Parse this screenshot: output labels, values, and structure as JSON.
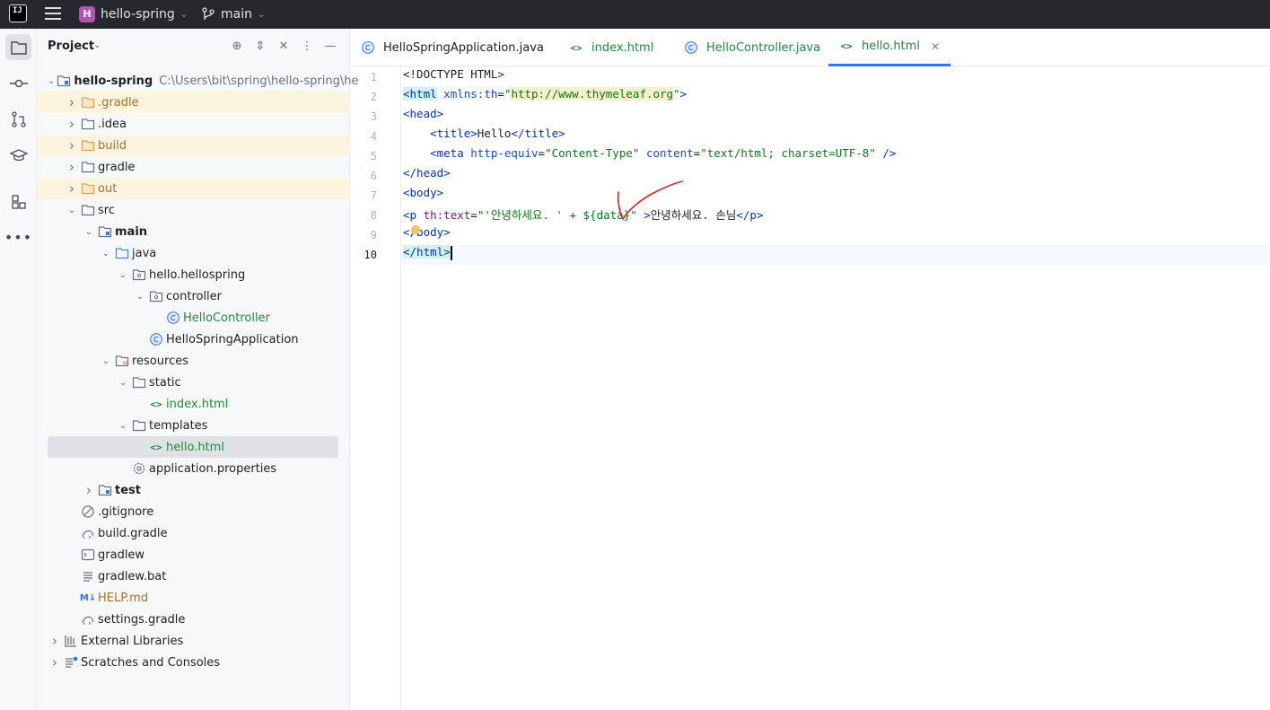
{
  "topbar": {
    "logo_text": "IJ",
    "project_badge": "H",
    "project_name": "hello-spring",
    "branch": "main"
  },
  "toolstrip": {
    "items": [
      "folder-icon",
      "commit-icon",
      "pull-requests-icon",
      "learn-icon",
      "structure-icon",
      "more-icon"
    ]
  },
  "project_panel": {
    "title": "Project",
    "tree": [
      {
        "label": "hello-spring",
        "path": "C:\\Users\\bit\\spring\\hello-spring\\he",
        "depth": 0,
        "expanded": true,
        "icon": "module-folder",
        "bold": true
      },
      {
        "label": ".gradle",
        "depth": 1,
        "expanded": false,
        "icon": "folder-excluded",
        "color": "orange",
        "excluded": true
      },
      {
        "label": ".idea",
        "depth": 1,
        "expanded": false,
        "icon": "folder"
      },
      {
        "label": "build",
        "depth": 1,
        "expanded": false,
        "icon": "folder-excluded",
        "color": "orange",
        "excluded": true
      },
      {
        "label": "gradle",
        "depth": 1,
        "expanded": false,
        "icon": "folder"
      },
      {
        "label": "out",
        "depth": 1,
        "expanded": false,
        "icon": "folder-excluded",
        "color": "orange",
        "excluded": true
      },
      {
        "label": "src",
        "depth": 1,
        "expanded": true,
        "icon": "folder"
      },
      {
        "label": "main",
        "depth": 2,
        "expanded": true,
        "icon": "module-folder",
        "bold": true
      },
      {
        "label": "java",
        "depth": 3,
        "expanded": true,
        "icon": "source-folder"
      },
      {
        "label": "hello.hellospring",
        "depth": 4,
        "expanded": true,
        "icon": "package"
      },
      {
        "label": "controller",
        "depth": 5,
        "expanded": true,
        "icon": "package"
      },
      {
        "label": "HelloController",
        "depth": 6,
        "icon": "class",
        "color": "green"
      },
      {
        "label": "HelloSpringApplication",
        "depth": 5,
        "icon": "class"
      },
      {
        "label": "resources",
        "depth": 3,
        "expanded": true,
        "icon": "resources-folder"
      },
      {
        "label": "static",
        "depth": 4,
        "expanded": true,
        "icon": "folder"
      },
      {
        "label": "index.html",
        "depth": 5,
        "icon": "html",
        "color": "green"
      },
      {
        "label": "templates",
        "depth": 4,
        "expanded": true,
        "icon": "folder"
      },
      {
        "label": "hello.html",
        "depth": 5,
        "icon": "html",
        "color": "green",
        "selected": true
      },
      {
        "label": "application.properties",
        "depth": 4,
        "icon": "settings"
      },
      {
        "label": "test",
        "depth": 2,
        "expanded": false,
        "icon": "module-folder",
        "bold": true
      },
      {
        "label": ".gitignore",
        "depth": 1,
        "icon": "ignore"
      },
      {
        "label": "build.gradle",
        "depth": 1,
        "icon": "gradle"
      },
      {
        "label": "gradlew",
        "depth": 1,
        "icon": "shell"
      },
      {
        "label": "gradlew.bat",
        "depth": 1,
        "icon": "text"
      },
      {
        "label": "HELP.md",
        "depth": 1,
        "icon": "markdown",
        "color": "orange"
      },
      {
        "label": "settings.gradle",
        "depth": 1,
        "icon": "gradle"
      },
      {
        "label": "External Libraries",
        "depth": 0,
        "expanded": false,
        "icon": "libraries"
      },
      {
        "label": "Scratches and Consoles",
        "depth": 0,
        "expanded": false,
        "icon": "scratches"
      }
    ]
  },
  "editor": {
    "tabs": [
      {
        "label": "HelloSpringApplication.java",
        "icon": "class",
        "active": false
      },
      {
        "label": "index.html",
        "icon": "html",
        "active": false,
        "color": "green"
      },
      {
        "label": "HelloController.java",
        "icon": "class",
        "active": false,
        "color": "green"
      },
      {
        "label": "hello.html",
        "icon": "html",
        "active": true,
        "color": "green",
        "closable": true
      }
    ],
    "current_line": 10,
    "lines": [
      "<!DOCTYPE HTML>",
      "<html xmlns:th=\"http://www.thymeleaf.org\">",
      "<head>",
      "    <title>Hello</title>",
      "    <meta http-equiv=\"Content-Type\" content=\"text/html; charset=UTF-8\" />",
      "</head>",
      "<body>",
      "<p th:text=\"'안녕하세요. ' + ${data}\" >안녕하세요. 손님</p>",
      "</body>",
      "</html>"
    ]
  },
  "colors": {
    "accent": "#3574f0",
    "excluded_bg": "#fdf4df",
    "selected_bg": "#dfe1e5",
    "annotation": "#e02020"
  }
}
